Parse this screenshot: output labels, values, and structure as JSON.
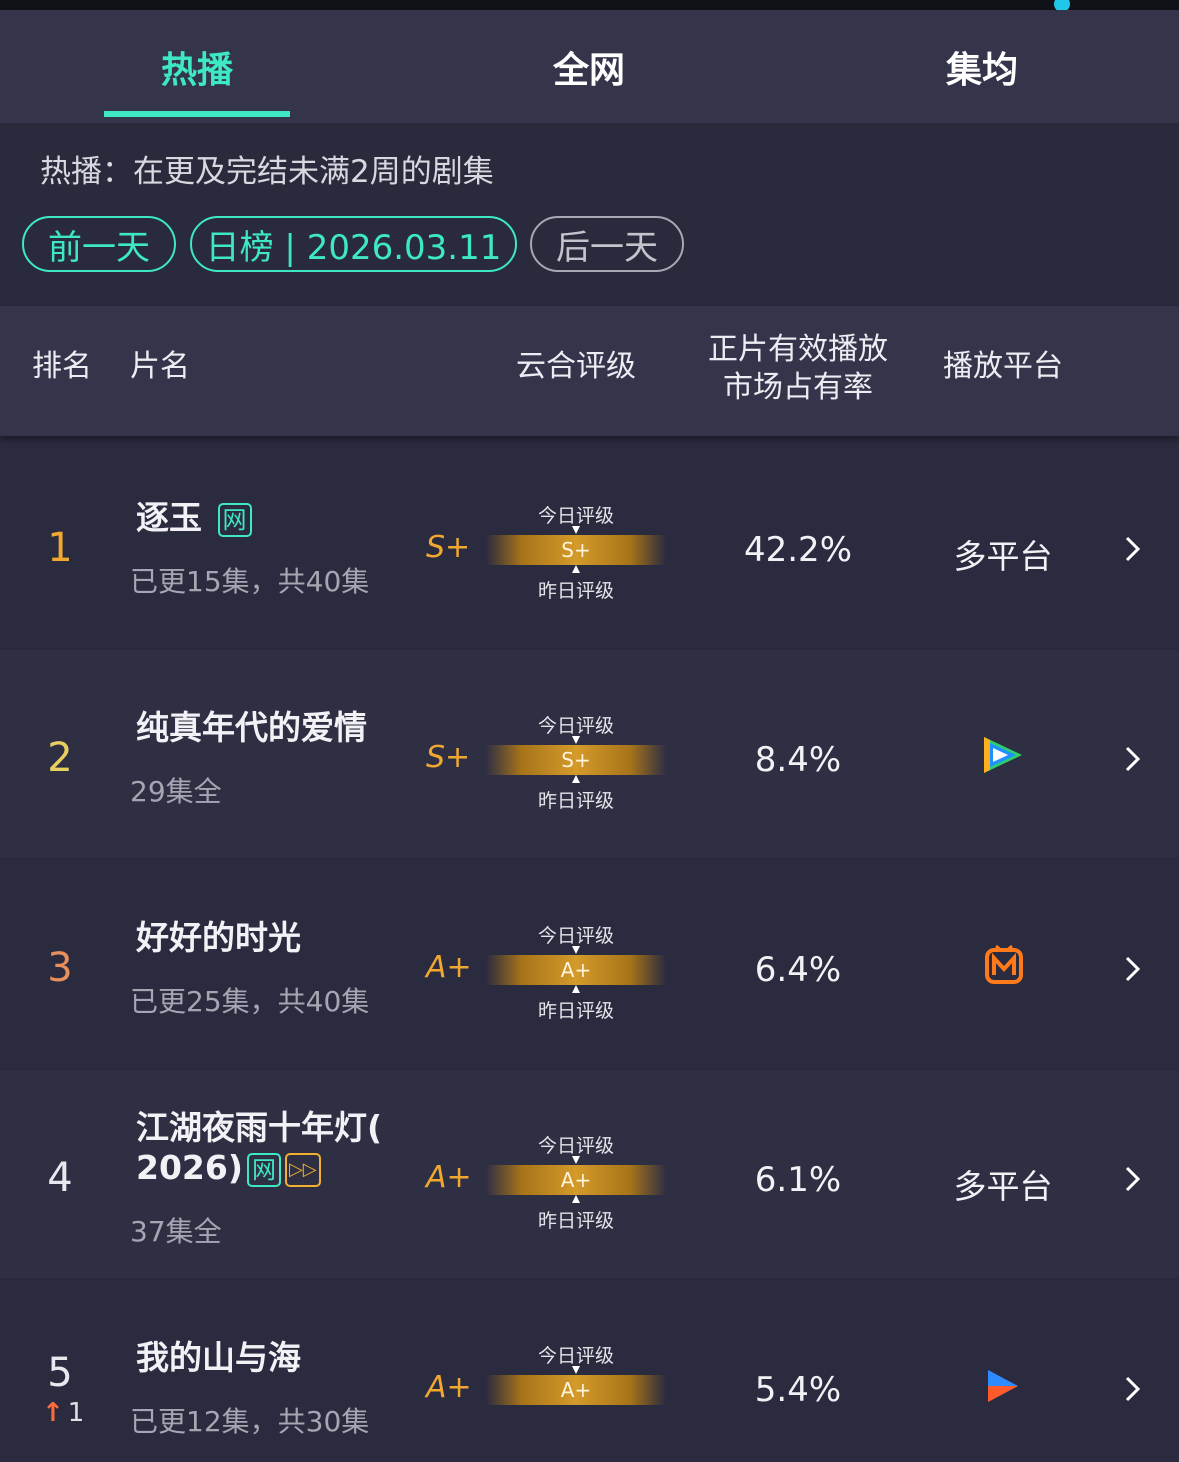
{
  "tabs": [
    {
      "label": "热播",
      "active": true
    },
    {
      "label": "全网",
      "active": false
    },
    {
      "label": "集均",
      "active": false
    }
  ],
  "description": "热播：在更及完结未满2周的剧集",
  "date_nav": {
    "prev": "前一天",
    "current": "日榜 | 2026.03.11",
    "next": "后一天"
  },
  "columns": {
    "rank": "排名",
    "title": "片名",
    "rating": "云合评级",
    "share_line1": "正片有效播放",
    "share_line2": "市场占有率",
    "platform": "播放平台"
  },
  "gauge_labels": {
    "today": "今日评级",
    "yesterday": "昨日评级"
  },
  "rows": [
    {
      "rank": "1",
      "title": "逐玉",
      "badges": [
        "网"
      ],
      "subtitle": "已更15集，共40集",
      "grade": "S+",
      "gauge_grade": "S+",
      "share": "42.2%",
      "platform_text": "多平台",
      "platform_icon": "",
      "rank_color": "#f0a830"
    },
    {
      "rank": "2",
      "title": "纯真年代的爱情",
      "badges": [],
      "subtitle": "29集全",
      "grade": "S+",
      "gauge_grade": "S+",
      "share": "8.4%",
      "platform_text": "",
      "platform_icon": "tencent-video-icon",
      "rank_color": "#e8d060"
    },
    {
      "rank": "3",
      "title": "好好的时光",
      "badges": [],
      "subtitle": "已更25集，共40集",
      "grade": "A+",
      "gauge_grade": "A+",
      "share": "6.4%",
      "platform_text": "",
      "platform_icon": "mango-tv-icon",
      "rank_color": "#e88f5a"
    },
    {
      "rank": "4",
      "title_line1": "江湖夜雨十年灯(",
      "title_line2": "2026)",
      "badges": [
        "网",
        "▷▷"
      ],
      "subtitle": "37集全",
      "grade": "A+",
      "gauge_grade": "A+",
      "share": "6.1%",
      "platform_text": "多平台",
      "platform_icon": "",
      "rank_color": "#e8e8ee"
    },
    {
      "rank": "5",
      "rank_change": "1",
      "title": "我的山与海",
      "badges": [],
      "subtitle": "已更12集，共30集",
      "grade": "A+",
      "gauge_grade": "A+",
      "share": "5.4%",
      "platform_text": "",
      "platform_icon": "youku-icon",
      "rank_color": "#e8e8ee"
    }
  ],
  "colors": {
    "accent": "#3de8c2",
    "grade_gold": "#f0a830",
    "background": "#2a2a3e"
  }
}
